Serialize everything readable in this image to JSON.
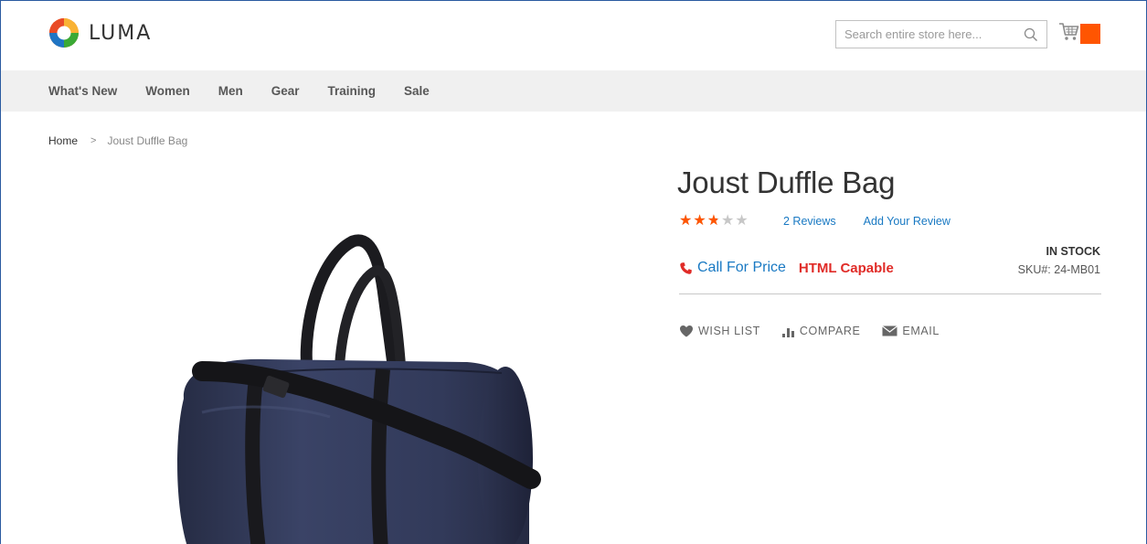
{
  "header": {
    "logo_text": "LUMA",
    "search_placeholder": "Search entire store here...",
    "icons": {
      "search": "search-icon",
      "cart": "cart-icon"
    },
    "accent_color": "#ff5501"
  },
  "nav": {
    "items": [
      {
        "label": "What's New"
      },
      {
        "label": "Women"
      },
      {
        "label": "Men"
      },
      {
        "label": "Gear"
      },
      {
        "label": "Training"
      },
      {
        "label": "Sale"
      }
    ]
  },
  "breadcrumb": {
    "home": "Home",
    "separator": ">",
    "current": "Joust Duffle Bag"
  },
  "product": {
    "title": "Joust Duffle Bag",
    "rating_fraction": 0.5,
    "reviews_label": "2 Reviews",
    "add_review_label": "Add Your Review",
    "call_for_price": "Call For Price",
    "html_capable": "HTML Capable",
    "stock_status": "IN STOCK",
    "sku_label": "SKU#:",
    "sku_value": "24-MB01",
    "colors": {
      "link": "#1979c3",
      "alert": "#e02b27",
      "star": "#ff5501"
    }
  },
  "actions": {
    "wish_list": "WISH LIST",
    "compare": "COMPARE",
    "email": "EMAIL"
  }
}
